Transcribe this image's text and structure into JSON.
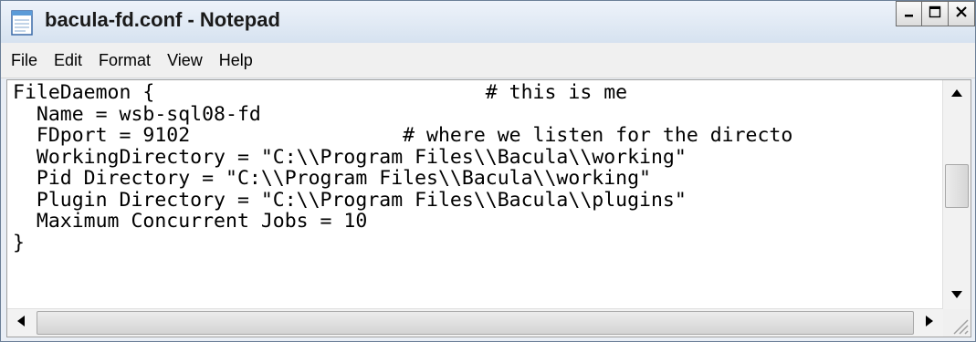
{
  "window": {
    "title": "bacula-fd.conf - Notepad",
    "icon": "notepad-icon"
  },
  "caption_buttons": [
    "minimize-icon",
    "maximize-icon",
    "close-icon"
  ],
  "menu": {
    "items": [
      {
        "label": "File"
      },
      {
        "label": "Edit"
      },
      {
        "label": "Format"
      },
      {
        "label": "View"
      },
      {
        "label": "Help"
      }
    ]
  },
  "editor": {
    "content": "FileDaemon {                            # this is me\n  Name = wsb-sql08-fd\n  FDport = 9102                  # where we listen for the directo\n  WorkingDirectory = \"C:\\\\Program Files\\\\Bacula\\\\working\"\n  Pid Directory = \"C:\\\\Program Files\\\\Bacula\\\\working\"\n  Plugin Directory = \"C:\\\\Program Files\\\\Bacula\\\\plugins\"\n  Maximum Concurrent Jobs = 10\n}"
  },
  "colors": {
    "titlebar": "#dbe6f3",
    "menubar": "#f0f0f0",
    "editor_bg": "#ffffff"
  }
}
